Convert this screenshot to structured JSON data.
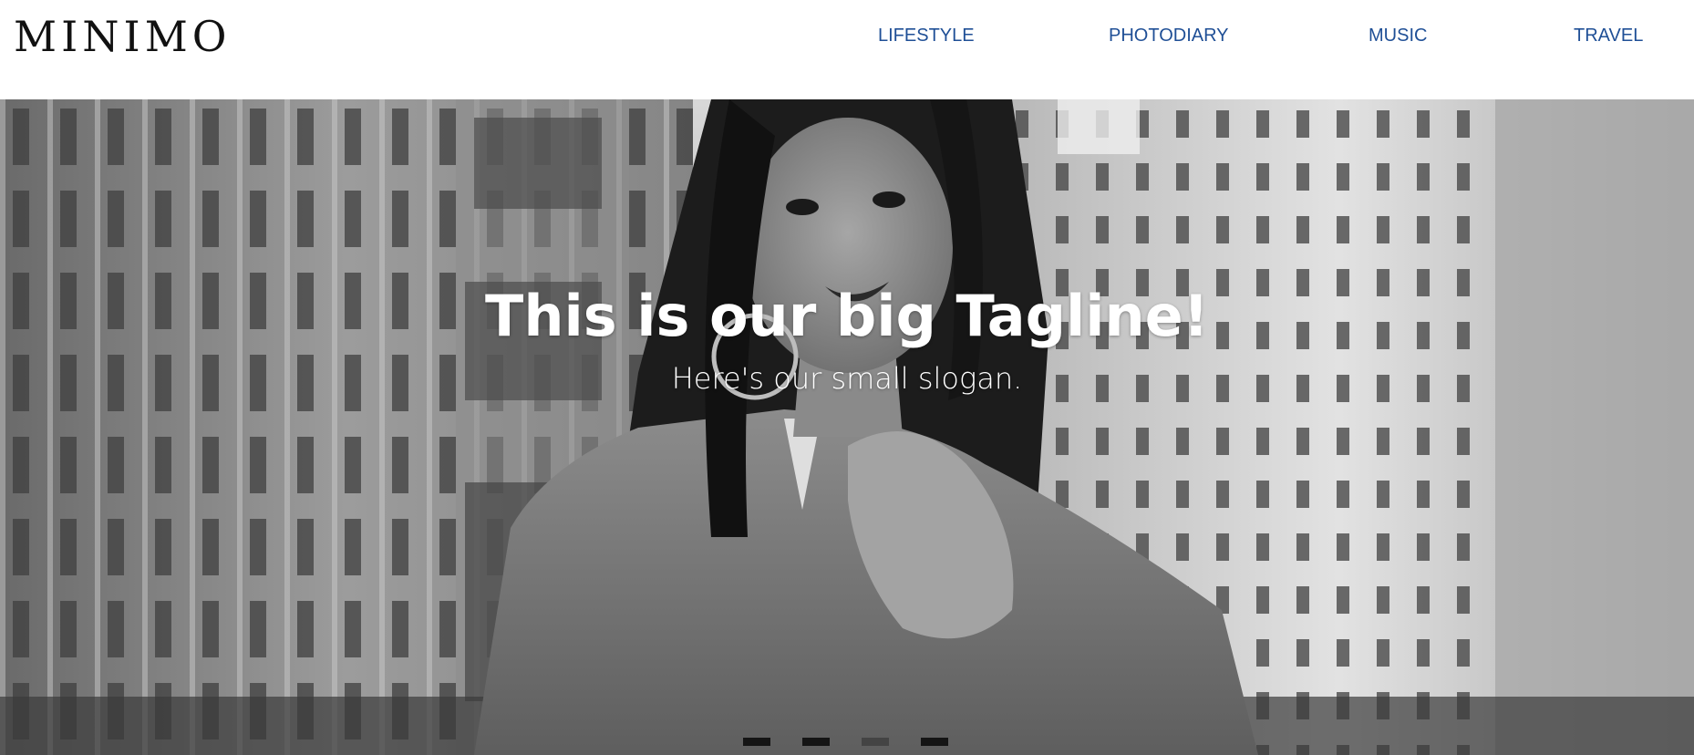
{
  "brand": {
    "logo_text": "MINIMO"
  },
  "nav": {
    "items": [
      "LIFESTYLE",
      "PHOTODIARY",
      "MUSIC",
      "TRAVEL"
    ]
  },
  "hero": {
    "tagline": "This is our big Tagline!",
    "slogan": "Here's our small slogan.",
    "image": "black-and-white-woman-portrait-city-buildings",
    "slides_total": 4,
    "active_slide": 3
  },
  "colors": {
    "nav_link": "#1f4f96",
    "logo": "#111111",
    "hero_text": "#ffffff"
  }
}
